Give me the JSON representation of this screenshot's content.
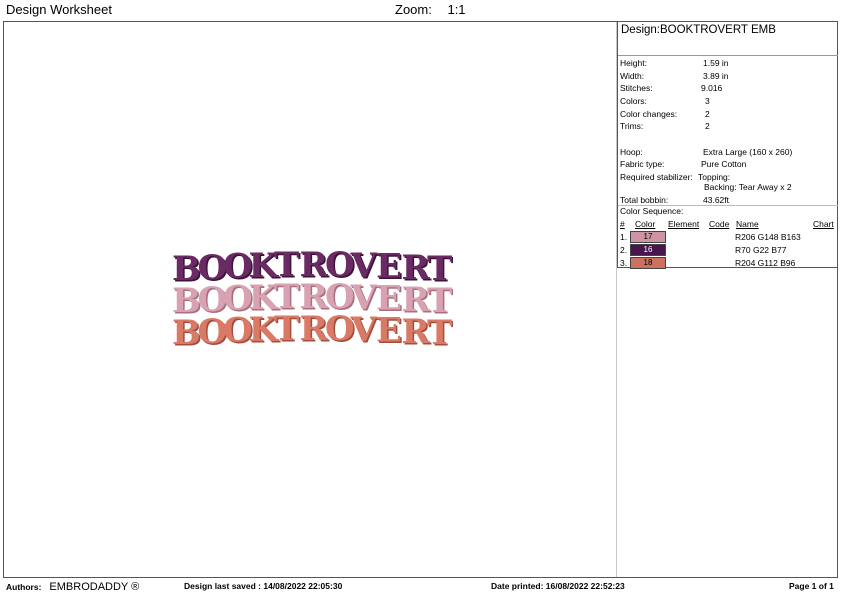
{
  "header": {
    "title": "Design Worksheet",
    "zoom_label": "Zoom:",
    "zoom_value": "1:1"
  },
  "design_title": "Design:BOOKTROVERT EMB",
  "specs": [
    {
      "label": "Height:",
      "value": "1.59 in"
    },
    {
      "label": "Width:",
      "value": "3.89 in"
    },
    {
      "label": "Stitches:",
      "value": "9.016"
    },
    {
      "label": "Colors:",
      "value": "3"
    },
    {
      "label": "Color changes:",
      "value": "2"
    },
    {
      "label": "Trims:",
      "value": "2"
    }
  ],
  "hoop": {
    "label": "Hoop:",
    "value": "Extra Large (160 x 260)"
  },
  "fabric": {
    "label": "Fabric type:",
    "value": "Pure Cotton"
  },
  "stabilizer": {
    "label": "Required stabilizer:",
    "topping": "Topping:",
    "backing": "Backing: Tear Away x 2"
  },
  "bobbin": {
    "label": "Total bobbin:",
    "value": "43.62ft"
  },
  "sequence": {
    "title": "Color Sequence:",
    "headers": {
      "num": "#",
      "color": "Color",
      "element": "Element",
      "code": "Code",
      "name": "Name",
      "chart": "Chart"
    },
    "rows": [
      {
        "num": "1.",
        "swatch": "17",
        "name": "R206 G148 B163",
        "color": "#ce94a3",
        "text_color": "#000000"
      },
      {
        "num": "2.",
        "swatch": "16",
        "name": "R70 G22 B77",
        "color": "#46164d",
        "text_color": "#ffffff"
      },
      {
        "num": "3.",
        "swatch": "18",
        "name": "R204 G112 B96",
        "color": "#cc7060",
        "text_color": "#000000"
      }
    ]
  },
  "artwork": {
    "word": "BOOKTROVERT",
    "colors": [
      "#6a2a63",
      "#d9a2b3",
      "#d97a66"
    ],
    "shadows": [
      "#3e1339",
      "#a8707f",
      "#a54c3c"
    ]
  },
  "footer": {
    "authors_label": "Authors:",
    "author": "EMBRODADDY ®",
    "saved": "Design last saved : 14/08/2022 22:05:30",
    "printed": "Date printed: 16/08/2022 22:52:23",
    "page": "Page 1 of 1"
  }
}
